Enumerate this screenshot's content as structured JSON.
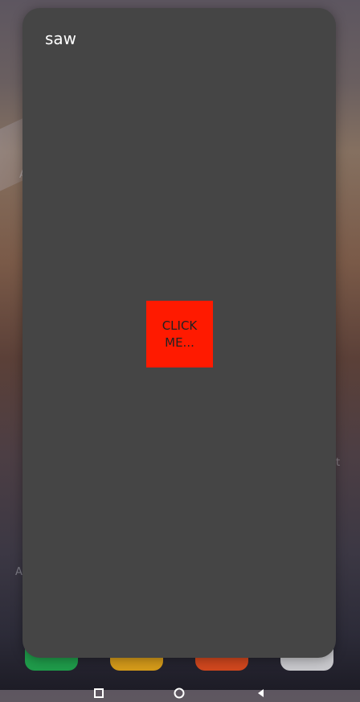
{
  "app": {
    "title": "saw",
    "button_label": "CLICK ME..."
  },
  "background": {
    "left_label": "A",
    "left_label_2": "A",
    "right_label": "t"
  },
  "dock": [
    {
      "icon": "phone-app-icon",
      "color": "#1f9b4a"
    },
    {
      "icon": "messages-app-icon",
      "color": "#d49a1a"
    },
    {
      "icon": "browser-app-icon",
      "color": "#d0471e"
    },
    {
      "icon": "camera-app-icon",
      "color": "#c8c8cc"
    }
  ],
  "colors": {
    "card_background": "#454545",
    "button_background": "#ff1a00",
    "title_text": "#ffffff"
  }
}
